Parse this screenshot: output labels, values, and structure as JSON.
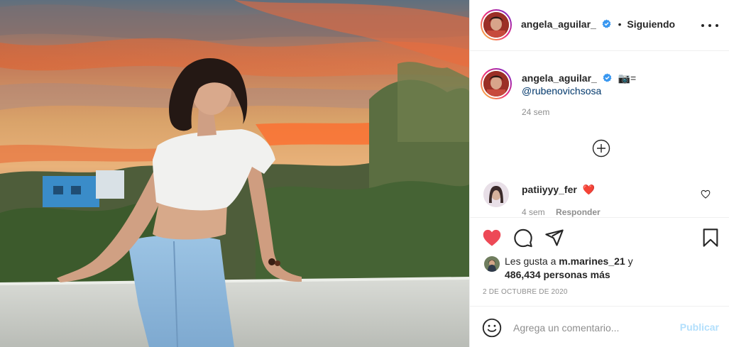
{
  "post": {
    "username": "angela_aguilar_",
    "follow_separator": "•",
    "follow_status": "Siguiendo"
  },
  "caption": {
    "username": "angela_aguilar_",
    "emoji": "📷=",
    "mention": "@rubenovichsosa",
    "age": "24 sem"
  },
  "comment": {
    "username": "patiiyyy_fer",
    "emoji": "❤️",
    "age": "4 sem",
    "reply_label": "Responder"
  },
  "likes": {
    "prefix": "Les gusta a",
    "user": "m.marines_21",
    "conjunction": "y",
    "count": "486,434 personas más"
  },
  "date": "2 DE OCTUBRE DE 2020",
  "add_comment": {
    "placeholder": "Agrega un comentario...",
    "publish_label": "Publicar"
  },
  "colors": {
    "like_red": "#ed4956",
    "verified_blue": "#3897f0",
    "publish_disabled": "#b2dffc"
  },
  "icons": [
    "verified-badge-icon",
    "more-options-icon",
    "add-comments-icon",
    "heart-filled-icon",
    "comment-icon",
    "share-icon",
    "bookmark-icon",
    "small-heart-icon",
    "emoji-icon"
  ]
}
